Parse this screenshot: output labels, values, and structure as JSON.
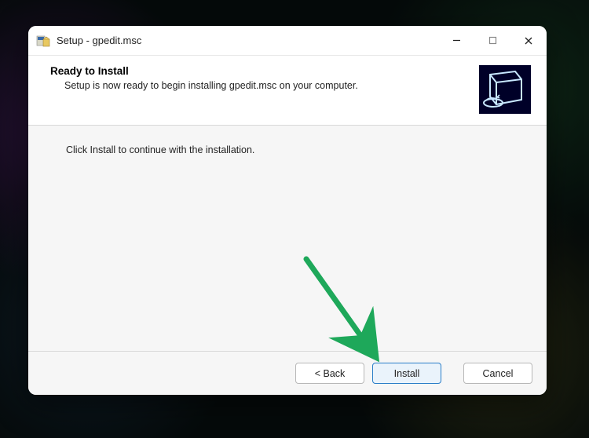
{
  "window": {
    "title": "Setup - gpedit.msc"
  },
  "header": {
    "title": "Ready to Install",
    "subtitle": "Setup is now ready to begin installing gpedit.msc on your computer."
  },
  "content": {
    "instruction": "Click Install to continue with the installation."
  },
  "footer": {
    "back_label": "< Back",
    "install_label": "Install",
    "cancel_label": "Cancel"
  },
  "colors": {
    "accent": "#2a7ec8",
    "annotation": "#1ea85a"
  }
}
